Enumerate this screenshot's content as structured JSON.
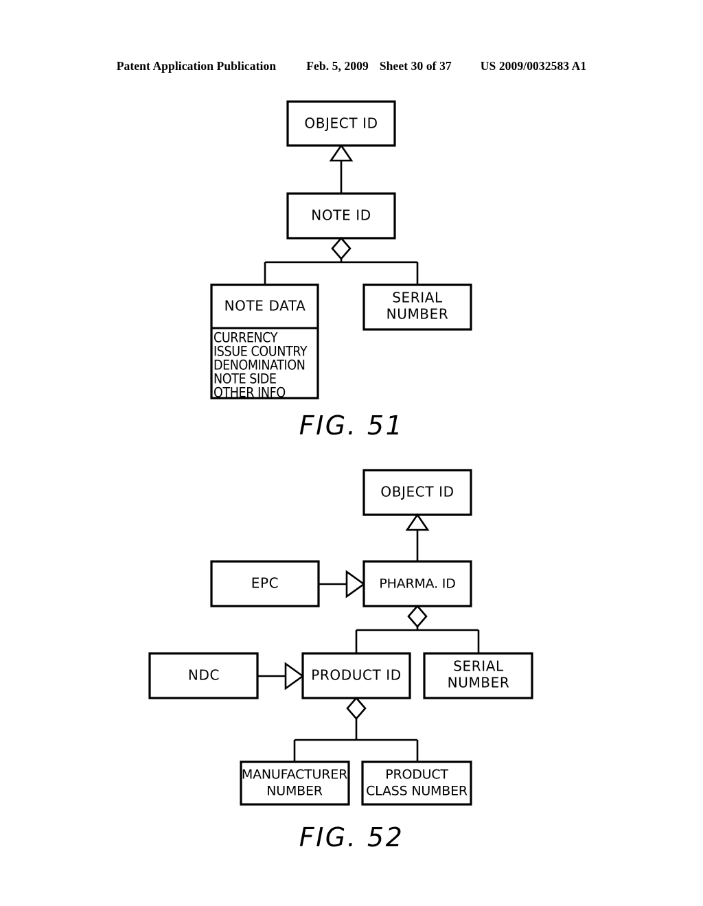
{
  "header": {
    "publication": "Patent Application Publication",
    "date": "Feb. 5, 2009",
    "sheet": "Sheet 30 of 37",
    "patent_number": "US 2009/0032583 A1"
  },
  "figures": [
    {
      "caption": "FIG. 51",
      "nodes": {
        "object_id": "OBJECT ID",
        "note_id": "NOTE ID",
        "note_data": "NOTE DATA",
        "serial_number_line1": "SERIAL",
        "serial_number_line2": "NUMBER"
      },
      "note_data_attributes": [
        "CURRENCY",
        "ISSUE COUNTRY",
        "DENOMINATION",
        "NOTE SIDE",
        "OTHER INFO"
      ]
    },
    {
      "caption": "FIG. 52",
      "nodes": {
        "object_id": "OBJECT ID",
        "epc": "EPC",
        "pharma_id": "PHARMA. ID",
        "ndc": "NDC",
        "product_id": "PRODUCT ID",
        "serial_number_line1": "SERIAL",
        "serial_number_line2": "NUMBER",
        "manufacturer_number_line1": "MANUFACTURER",
        "manufacturer_number_line2": "NUMBER",
        "product_class_number_line1": "PRODUCT",
        "product_class_number_line2": "CLASS NUMBER"
      }
    }
  ],
  "colors": {
    "ink": "#000000",
    "paper": "#ffffff"
  }
}
